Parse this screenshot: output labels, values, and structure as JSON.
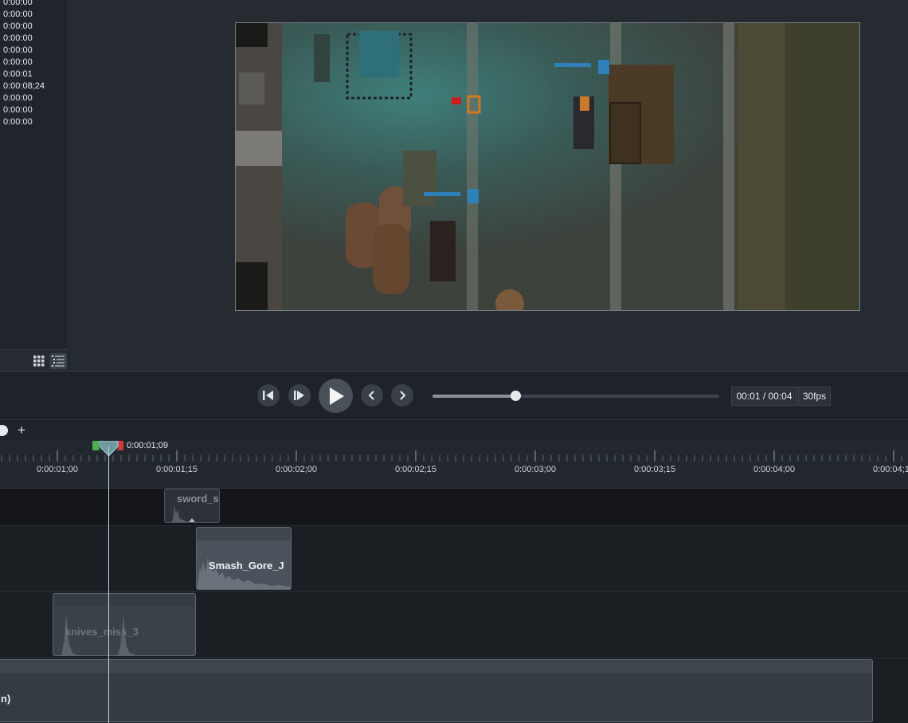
{
  "media_list": {
    "durations": [
      "0:00:00",
      "0:00:00",
      "0:00:00",
      "0:00:00",
      "0:00:00",
      "0:00:00",
      "0:00:01",
      "0:00:08;24",
      "0:00:00",
      "0:00:00",
      "0:00:00"
    ],
    "grid_view_icon": "grid-icon",
    "list_view_icon": "list-icon"
  },
  "playback": {
    "time_display": "00:01 / 00:04",
    "fps": "30fps",
    "progress_fraction": 0.29
  },
  "timeline": {
    "add_track_label": "+",
    "playhead_time": "0:00:01;09",
    "ruler_labels": [
      "0:00:01;00",
      "0:00:01;15",
      "0:00:02;00",
      "0:00:02;15",
      "0:00:03;00",
      "0:00:03;15",
      "0:00:04;00",
      "0:00:04;1"
    ],
    "clips": {
      "sword": "sword_s",
      "smash": "Smash_Gore_J",
      "knives": "knives_miss_3",
      "main": "n)"
    }
  },
  "colors": {
    "accent_teal": "#5f8f96",
    "in_marker": "#4caf50",
    "out_marker": "#d43a3a"
  }
}
